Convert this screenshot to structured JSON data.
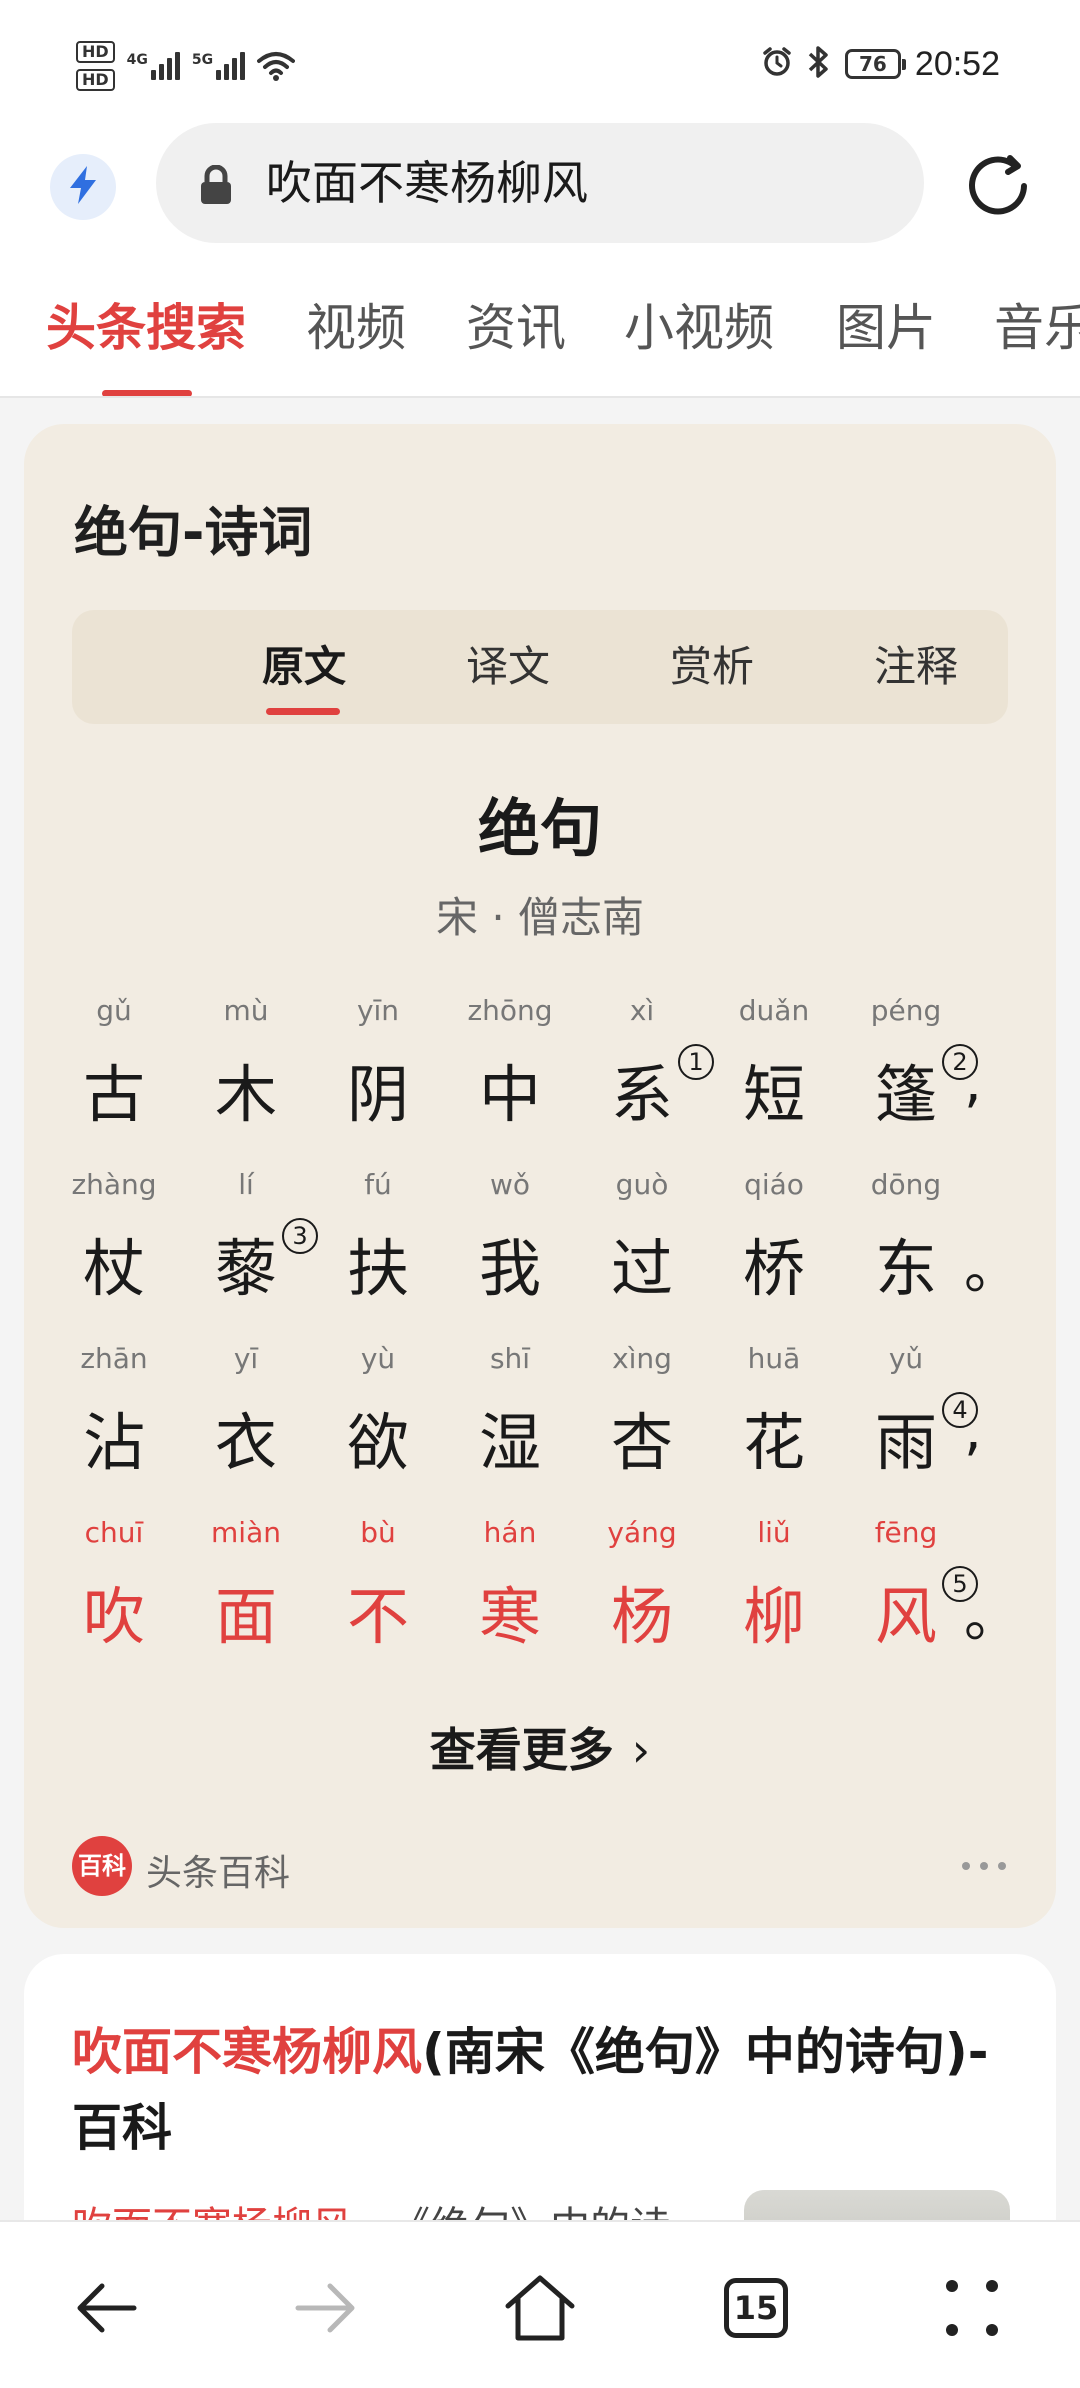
{
  "status_bar": {
    "hd1": "HD",
    "hd2": "HD",
    "net1": "4G",
    "net2": "5G",
    "battery": "76",
    "time": "20:52"
  },
  "address_bar": {
    "query": "吹面不寒杨柳风"
  },
  "tabs": [
    {
      "label": "头条搜索"
    },
    {
      "label": "视频"
    },
    {
      "label": "资讯"
    },
    {
      "label": "小视频"
    },
    {
      "label": "图片"
    },
    {
      "label": "音乐"
    }
  ],
  "poem_card": {
    "header": "绝句-诗词",
    "subtabs": [
      {
        "label": "原文"
      },
      {
        "label": "译文"
      },
      {
        "label": "赏析"
      },
      {
        "label": "注释"
      }
    ],
    "title": "绝句",
    "author": "宋 · 僧志南",
    "lines": [
      {
        "chars": [
          {
            "py": "gǔ",
            "hz": "古"
          },
          {
            "py": "mù",
            "hz": "木"
          },
          {
            "py": "yīn",
            "hz": "阴"
          },
          {
            "py": "zhōng",
            "hz": "中"
          },
          {
            "py": "xì",
            "hz": "系",
            "note": "1"
          },
          {
            "py": "duǎn",
            "hz": "短"
          },
          {
            "py": "péng",
            "hz": "篷",
            "note": "2"
          }
        ],
        "punct": ","
      },
      {
        "chars": [
          {
            "py": "zhàng",
            "hz": "杖"
          },
          {
            "py": "lí",
            "hz": "藜",
            "note": "3"
          },
          {
            "py": "fú",
            "hz": "扶"
          },
          {
            "py": "wǒ",
            "hz": "我"
          },
          {
            "py": "guò",
            "hz": "过"
          },
          {
            "py": "qiáo",
            "hz": "桥"
          },
          {
            "py": "dōng",
            "hz": "东"
          }
        ],
        "punct": "。"
      },
      {
        "chars": [
          {
            "py": "zhān",
            "hz": "沾"
          },
          {
            "py": "yī",
            "hz": "衣"
          },
          {
            "py": "yù",
            "hz": "欲"
          },
          {
            "py": "shī",
            "hz": "湿"
          },
          {
            "py": "xìng",
            "hz": "杏"
          },
          {
            "py": "huā",
            "hz": "花"
          },
          {
            "py": "yǔ",
            "hz": "雨",
            "note": "4"
          }
        ],
        "punct": ","
      },
      {
        "chars": [
          {
            "py": "chuī",
            "hz": "吹"
          },
          {
            "py": "miàn",
            "hz": "面"
          },
          {
            "py": "bù",
            "hz": "不"
          },
          {
            "py": "hán",
            "hz": "寒"
          },
          {
            "py": "yáng",
            "hz": "杨"
          },
          {
            "py": "liǔ",
            "hz": "柳"
          },
          {
            "py": "fēng",
            "hz": "风",
            "note": "5"
          }
        ],
        "punct": "。",
        "highlight": true
      }
    ],
    "more_label": "查看更多",
    "source_logo": "百科",
    "source_name": "头条百科"
  },
  "result": {
    "title_highlight": "吹面不寒杨柳风",
    "title_rest": "(南宋《绝句》中的诗句)-百科",
    "snippet_highlight": "吹面不寒杨柳风",
    "snippet_rest": "...《绝句》中的诗"
  },
  "bottom_nav": {
    "tab_count": "15"
  },
  "colors": {
    "accent": "#e0413f",
    "card_bg": "#f2ece2",
    "bolt": "#2f6fe0"
  },
  "icons": [
    "bolt-icon",
    "lock-icon",
    "refresh-icon",
    "back-icon",
    "forward-icon",
    "home-icon",
    "tabs-icon",
    "menu-icon",
    "alarm-icon",
    "bluetooth-icon",
    "wifi-icon"
  ]
}
